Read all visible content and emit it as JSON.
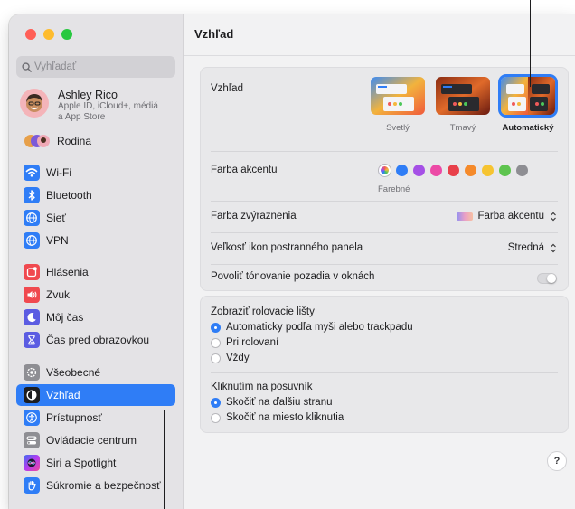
{
  "window": {
    "page_title": "Vzhľad"
  },
  "sidebar": {
    "search_placeholder": "Vyhľadať",
    "account": {
      "name": "Ashley Rico",
      "subtitle_line1": "Apple ID, iCloud+, médiá",
      "subtitle_line2": "a App Store"
    },
    "family_label": "Rodina",
    "items": [
      {
        "label": "Wi-Fi",
        "icon": "wifi-icon",
        "color": "#2f7df6"
      },
      {
        "label": "Bluetooth",
        "icon": "bluetooth-icon",
        "color": "#2f7df6"
      },
      {
        "label": "Sieť",
        "icon": "globe-icon",
        "color": "#2f7df6"
      },
      {
        "label": "VPN",
        "icon": "vpn-globe-icon",
        "color": "#2f7df6"
      },
      {
        "label": "Hlásenia",
        "icon": "notifications-icon",
        "color": "#f0494f"
      },
      {
        "label": "Zvuk",
        "icon": "speaker-icon",
        "color": "#f0494f"
      },
      {
        "label": "Môj čas",
        "icon": "focus-moon-icon",
        "color": "#5b5ce2"
      },
      {
        "label": "Čas pred obrazovkou",
        "icon": "hourglass-icon",
        "color": "#5b5ce2"
      },
      {
        "label": "Všeobecné",
        "icon": "gear-icon",
        "color": "#8e8e93"
      },
      {
        "label": "Vzhľad",
        "icon": "appearance-icon",
        "color": "#1d1d1f"
      },
      {
        "label": "Prístupnosť",
        "icon": "accessibility-icon",
        "color": "#2f7df6"
      },
      {
        "label": "Ovládacie centrum",
        "icon": "control-center-icon",
        "color": "#8e8e93"
      },
      {
        "label": "Siri a Spotlight",
        "icon": "siri-icon",
        "color": "#7a3cf0"
      },
      {
        "label": "Súkromie a bezpečnosť",
        "icon": "privacy-hand-icon",
        "color": "#2f7df6"
      }
    ],
    "active_item": "Vzhľad"
  },
  "appearance": {
    "label": "Vzhľad",
    "options": [
      {
        "label": "Svetlý"
      },
      {
        "label": "Tmavý"
      },
      {
        "label": "Automatický"
      }
    ],
    "selected": "Automatický"
  },
  "accent": {
    "label": "Farba akcentu",
    "multicolor_label": "Farebné",
    "colors": [
      "#2f7df6",
      "#a550e6",
      "#ec4aa6",
      "#e8404a",
      "#f58a2b",
      "#f6c431",
      "#5ec44f",
      "#8e8e93"
    ]
  },
  "highlight": {
    "label": "Farba zvýraznenia",
    "value": "Farba akcentu"
  },
  "sidebar_icon_size": {
    "label": "Veľkosť ikon postranného panela",
    "value": "Stredná"
  },
  "wallpaper_tinting": {
    "label": "Povoliť tónovanie pozadia v oknách",
    "enabled": false
  },
  "scrollbars": {
    "title": "Zobraziť rolovacie lišty",
    "options": [
      "Automaticky podľa myši alebo trackpadu",
      "Pri rolovaní",
      "Vždy"
    ],
    "selected_index": 0
  },
  "click_scrollbar": {
    "title": "Kliknutím na posuvník",
    "options": [
      "Skočiť na ďalšiu stranu",
      "Skočiť na miesto kliknutia"
    ],
    "selected_index": 0
  },
  "help_label": "?"
}
